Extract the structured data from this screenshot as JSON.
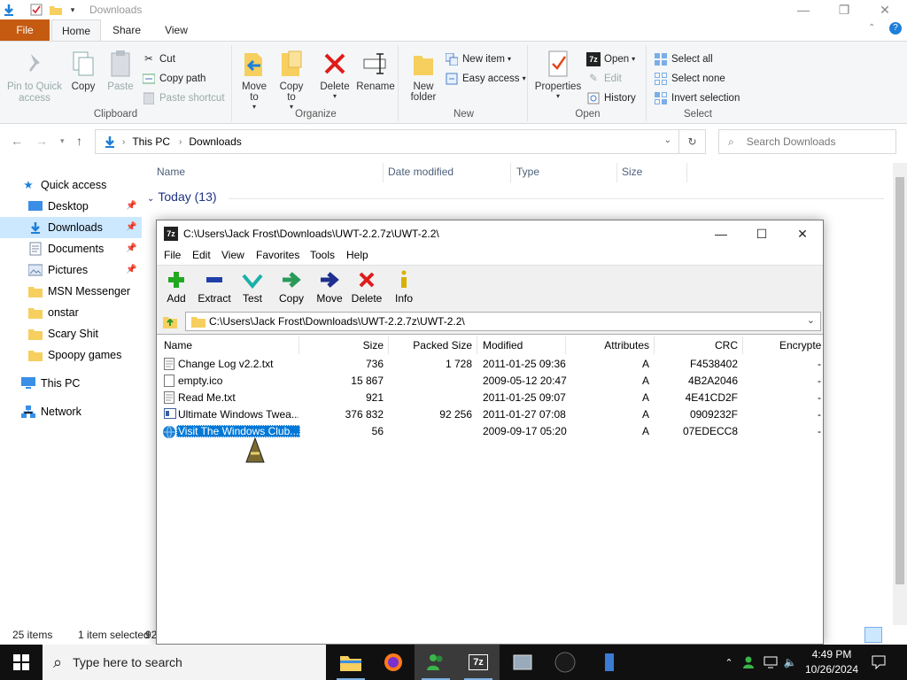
{
  "explorer": {
    "title": "Downloads",
    "tabs": {
      "file": "File",
      "home": "Home",
      "share": "Share",
      "view": "View"
    },
    "ribbon": {
      "clipboard": {
        "label": "Clipboard",
        "pin": "Pin to Quick access",
        "copy": "Copy",
        "paste": "Paste",
        "cut": "Cut",
        "copy_path": "Copy path",
        "paste_shortcut": "Paste shortcut"
      },
      "organize": {
        "label": "Organize",
        "move_to": "Move to",
        "copy_to": "Copy to",
        "delete": "Delete",
        "rename": "Rename"
      },
      "new": {
        "label": "New",
        "new_folder": "New folder",
        "new_item": "New item",
        "easy_access": "Easy access"
      },
      "open": {
        "label": "Open",
        "properties": "Properties",
        "open": "Open",
        "edit": "Edit",
        "history": "History"
      },
      "select": {
        "label": "Select",
        "select_all": "Select all",
        "select_none": "Select none",
        "invert": "Invert selection"
      }
    },
    "address": {
      "this_pc": "This PC",
      "downloads": "Downloads",
      "search_placeholder": "Search Downloads"
    },
    "nav": {
      "quick_access": "Quick access",
      "items": [
        "Desktop",
        "Downloads",
        "Documents",
        "Pictures",
        "MSN Messenger",
        "onstar",
        "Scary Shit",
        "Spoopy games"
      ],
      "this_pc": "This PC",
      "network": "Network"
    },
    "columns": {
      "name": "Name",
      "date": "Date modified",
      "type": "Type",
      "size": "Size"
    },
    "group": "Today (13)",
    "status": {
      "items": "25 items",
      "selected": "1 item selected",
      "trunc": "92"
    }
  },
  "sevenzip": {
    "title": "C:\\Users\\Jack Frost\\Downloads\\UWT-2.2.7z\\UWT-2.2\\",
    "menu": [
      "File",
      "Edit",
      "View",
      "Favorites",
      "Tools",
      "Help"
    ],
    "toolbar": {
      "add": "Add",
      "extract": "Extract",
      "test": "Test",
      "copy": "Copy",
      "move": "Move",
      "delete": "Delete",
      "info": "Info"
    },
    "path": "C:\\Users\\Jack Frost\\Downloads\\UWT-2.2.7z\\UWT-2.2\\",
    "columns": {
      "name": "Name",
      "size": "Size",
      "packed": "Packed Size",
      "modified": "Modified",
      "attributes": "Attributes",
      "crc": "CRC",
      "encrypted": "Encrypte"
    },
    "rows": [
      {
        "name": "Change Log v2.2.txt",
        "size": "736",
        "packed": "1 728",
        "modified": "2011-01-25 09:36",
        "attr": "A",
        "crc": "F4538402",
        "enc": "-"
      },
      {
        "name": "empty.ico",
        "size": "15 867",
        "packed": "",
        "modified": "2009-05-12 20:47",
        "attr": "A",
        "crc": "4B2A2046",
        "enc": "-"
      },
      {
        "name": "Read Me.txt",
        "size": "921",
        "packed": "",
        "modified": "2011-01-25 09:07",
        "attr": "A",
        "crc": "4E41CD2F",
        "enc": "-"
      },
      {
        "name": "Ultimate Windows Twea...",
        "size": "376 832",
        "packed": "92 256",
        "modified": "2011-01-27 07:08",
        "attr": "A",
        "crc": "0909232F",
        "enc": "-"
      },
      {
        "name": "Visit The Windows Club....",
        "size": "56",
        "packed": "",
        "modified": "2009-09-17 05:20",
        "attr": "A",
        "crc": "07EDECC8",
        "enc": "-"
      }
    ]
  },
  "taskbar": {
    "search_placeholder": "Type here to search",
    "time": "4:49 PM",
    "date": "10/26/2024"
  },
  "colors": {
    "accent": "#0078d7",
    "file_tab": "#c55a11",
    "taskbar": "#101010",
    "nav_selected": "#cce8ff"
  }
}
